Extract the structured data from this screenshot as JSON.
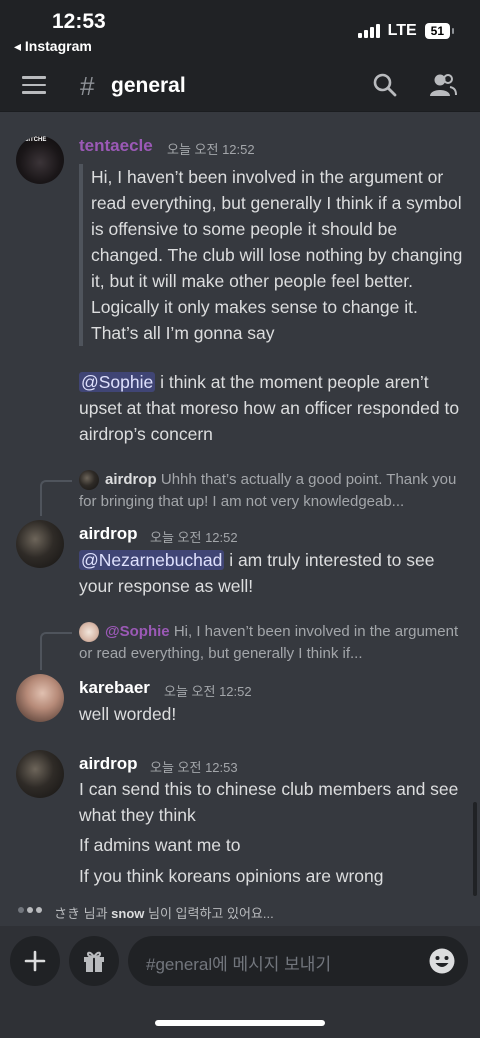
{
  "status_bar": {
    "time": "12:53",
    "back_label": "◂ Instagram",
    "network": "LTE",
    "battery": "51"
  },
  "header": {
    "hash_symbol": "#",
    "channel_name": "general"
  },
  "messages": [
    {
      "author": "tentaecle",
      "author_color": "#9b59b6",
      "timestamp": "오늘 오전 12:52",
      "avatar_text": "BITCHE",
      "quote": "Hi, I haven’t been involved in the argument or read everything, but generally I think if a symbol is offensive to some people it should be changed. The club will lose nothing by changing it, but it will make other people feel better. Logically it only makes sense to change it. That’s all I’m gonna say",
      "mention": "@Sophie",
      "text": " i think at the moment people aren’t upset at that moreso how an officer responded to airdrop’s concern"
    },
    {
      "reply_to": {
        "author": "airdrop",
        "preview": "Uhhh that’s actually a good point. Thank you for bringing that up! I am not very knowledgeab..."
      },
      "author": "airdrop",
      "timestamp": "오늘 오전 12:52",
      "mention": "@Nezarnebuchad",
      "text": " i am truly interested to see your response as well!"
    },
    {
      "reply_to": {
        "author": "@Sophie",
        "preview": "Hi, I haven’t been involved in the argument or read everything, but generally I think if..."
      },
      "author": "karebaer",
      "timestamp": "오늘 오전 12:52",
      "text": "well worded!"
    },
    {
      "author": "airdrop",
      "timestamp": "오늘 오전 12:53",
      "lines": [
        "I can send this to chinese club members and see what they think",
        "If admins want me to",
        "If you think koreans opinions are wrong"
      ]
    }
  ],
  "typing_indicator": {
    "user1": "さき",
    "middle": " 님과 ",
    "user2": "snow",
    "suffix": " 님이 입력하고 있어요..."
  },
  "composer": {
    "placeholder": "#general에 메시지 보내기"
  },
  "colors": {
    "background": "#36393f",
    "header": "#202225",
    "mention_bg": "#4a4f8a",
    "accent_purple": "#9b59b6"
  },
  "icons": [
    "hamburger-menu-icon",
    "search-icon",
    "members-icon",
    "plus-icon",
    "gift-icon",
    "emoji-icon"
  ]
}
